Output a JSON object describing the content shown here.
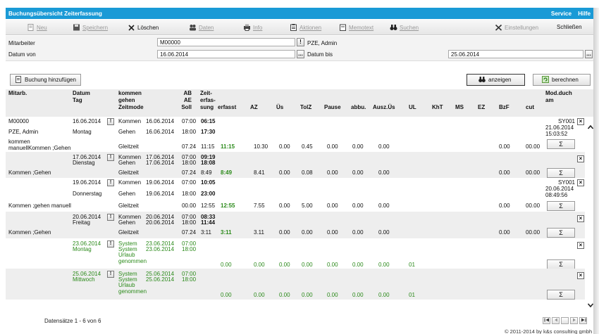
{
  "window": {
    "title": "Buchungsübersicht Zeiterfassung",
    "menu_service": "Service",
    "menu_help": "Hilfe"
  },
  "toolbar": {
    "new": "Neu",
    "save": "Speichern",
    "delete": "Löschen",
    "data": "Daten",
    "info": "Info",
    "update": "Aktionen",
    "memo": "Memotext",
    "search": "Suchen",
    "settings": "Einstellungen",
    "close": "Schließen"
  },
  "form": {
    "employee_label": "Mitarbeiter",
    "employee_value": "M00000",
    "employee_name": "PZE, Admin",
    "date_from_label": "Datum von",
    "date_from_value": "16.06.2014",
    "date_to_label": "Datum bis",
    "date_to_value": "25.06.2014",
    "more": "..."
  },
  "actions": {
    "add": "Buchung hinzufügen",
    "show": "anzeigen",
    "calc": "berechnen"
  },
  "columns": {
    "mitarb": "Mitarb.",
    "datum": "Datum",
    "tag": "Tag",
    "kommen": "kommen",
    "gehen": "gehen",
    "zeitmode": "Zeitmode",
    "ab": "AB",
    "ae": "AE",
    "soll": "Soll",
    "zeit": "Zeit-",
    "erfas": "erfas-",
    "sung": "sung",
    "erfasst": "erfasst",
    "az": "AZ",
    "us": "Üs",
    "tolz": "TolZ",
    "pause": "Pause",
    "abbu": "abbu.",
    "auszus": "Ausz.Üs",
    "ul": "UL",
    "kht": "KhT",
    "ms": "MS",
    "ez": "EZ",
    "bzf": "BzF",
    "cut": "cut",
    "mod1": "Mod.duch",
    "mod2": "am"
  },
  "rows": [
    {
      "mitarb": [
        "M00000",
        "PZE, Admin"
      ],
      "mitarb_note": [
        "kommen",
        "manuellKommen ;Gehen"
      ],
      "date": "16.06.2014",
      "day": "Montag",
      "b1": {
        "type": "Kommen",
        "date": "16.06.2014",
        "soll": "07:00",
        "time": "06:15"
      },
      "b2": {
        "type": "Gehen",
        "date": "16.06.2014",
        "soll": "18:00",
        "time": "17:30"
      },
      "mode": "Gleitzeit",
      "soll": "07.24",
      "sung": "11:15",
      "erfasst": "11:15",
      "az": "10.30",
      "us": "0.00",
      "tolz": "0.45",
      "pause": "0.00",
      "abbu": "0.00",
      "auszus": "0.00",
      "ul": "",
      "bzf": "0.00",
      "cut": "00.00",
      "mod_by": "SY001",
      "mod_date": "21.06.2014",
      "mod_time": "15:03:52"
    },
    {
      "mitarb_note": [
        "Kommen ;Gehen"
      ],
      "date": "17.06.2014",
      "day": "Dienstag",
      "b1": {
        "type": "Kommen",
        "date": "17.06.2014",
        "soll": "07:00",
        "time": "09:19"
      },
      "b2": {
        "type": "Gehen",
        "date": "17.06.2014",
        "soll": "18:00",
        "time": "18:08"
      },
      "mode": "Gleitzeit",
      "soll": "07.24",
      "sung": "8:49",
      "erfasst": "8:49",
      "az": "8.41",
      "us": "0.00",
      "tolz": "0.08",
      "pause": "0.00",
      "abbu": "0.00",
      "auszus": "0.00",
      "ul": "",
      "bzf": "0.00",
      "cut": "00.00"
    },
    {
      "mitarb_note": [
        "Kommen ;gehen manuell"
      ],
      "date": "19.06.2014",
      "day": "Donnerstag",
      "b1": {
        "type": "Kommen",
        "date": "19.06.2014",
        "soll": "07:00",
        "time": "10:05"
      },
      "b2": {
        "type": "Gehen",
        "date": "19.06.2014",
        "soll": "18:00",
        "time": "23:00"
      },
      "mode": "Gleitzeit",
      "soll": "00.00",
      "sung": "12:55",
      "erfasst": "12:55",
      "az": "7.55",
      "us": "0.00",
      "tolz": "5.00",
      "pause": "0.00",
      "abbu": "0.00",
      "auszus": "0.00",
      "ul": "",
      "bzf": "0.00",
      "cut": "00.00",
      "mod_by": "SY001",
      "mod_date": "20.06.2014",
      "mod_time": "08:49:56"
    },
    {
      "mitarb_note": [
        "Kommen ;Gehen"
      ],
      "date": "20.06.2014",
      "day": "Freitag",
      "b1": {
        "type": "Kommen",
        "date": "20.06.2014",
        "soll": "07:00",
        "time": "08:33"
      },
      "b2": {
        "type": "Gehen",
        "date": "20.06.2014",
        "soll": "18:00",
        "time": "11:44"
      },
      "mode": "Gleitzeit",
      "soll": "07.24",
      "sung": "3:11",
      "erfasst": "3:11",
      "az": "3.11",
      "us": "0.00",
      "tolz": "0.00",
      "pause": "0.00",
      "abbu": "0.00",
      "auszus": "0.00",
      "ul": "",
      "bzf": "0.00",
      "cut": "00.00"
    },
    {
      "date": "23.06.2014",
      "day": "Montag",
      "b1": {
        "type": "System",
        "date": "23.06.2014",
        "soll": "07:00"
      },
      "b2": {
        "type": "System",
        "date": "23.06.2014",
        "soll": "18:00"
      },
      "mode": [
        "Urlaub",
        "genommen"
      ],
      "erfasst": "0.00",
      "az": "0.00",
      "us": "0.00",
      "tolz": "0.00",
      "pause": "0.00",
      "abbu": "0.00",
      "auszus": "0.00",
      "ul": "01"
    },
    {
      "date": "25.06.2014",
      "day": "Mittwoch",
      "b1": {
        "type": "System",
        "date": "25.06.2014",
        "soll": "07:00"
      },
      "b2": {
        "type": "System",
        "date": "25.06.2014",
        "soll": "18:00"
      },
      "mode": [
        "Urlaub",
        "genommen"
      ],
      "erfasst": "0.00",
      "az": "0.00",
      "us": "0.00",
      "tolz": "0.00",
      "pause": "0.00",
      "abbu": "0.00",
      "auszus": "0.00",
      "ul": "01"
    }
  ],
  "symbols": {
    "info": "!",
    "sigma": "Σ",
    "remove": "×",
    "up": "^",
    "down": "v"
  },
  "footer": {
    "records": "Datensätze 1 - 6 von 6",
    "copyright": "© 2011-2014 by k&s consulting gmbh"
  },
  "icons": [
    "doc-icon",
    "floppy-icon",
    "x-icon",
    "people-icon",
    "printer-icon",
    "clipboard-icon",
    "memo-icon",
    "binoculars-icon",
    "tools-icon",
    "refresh-icon"
  ],
  "colors": {
    "titlebar": "#1a9ad6",
    "green_text": "#2b8a1a",
    "alt_row": "#eeeeee",
    "header_bg": "#ececec"
  }
}
